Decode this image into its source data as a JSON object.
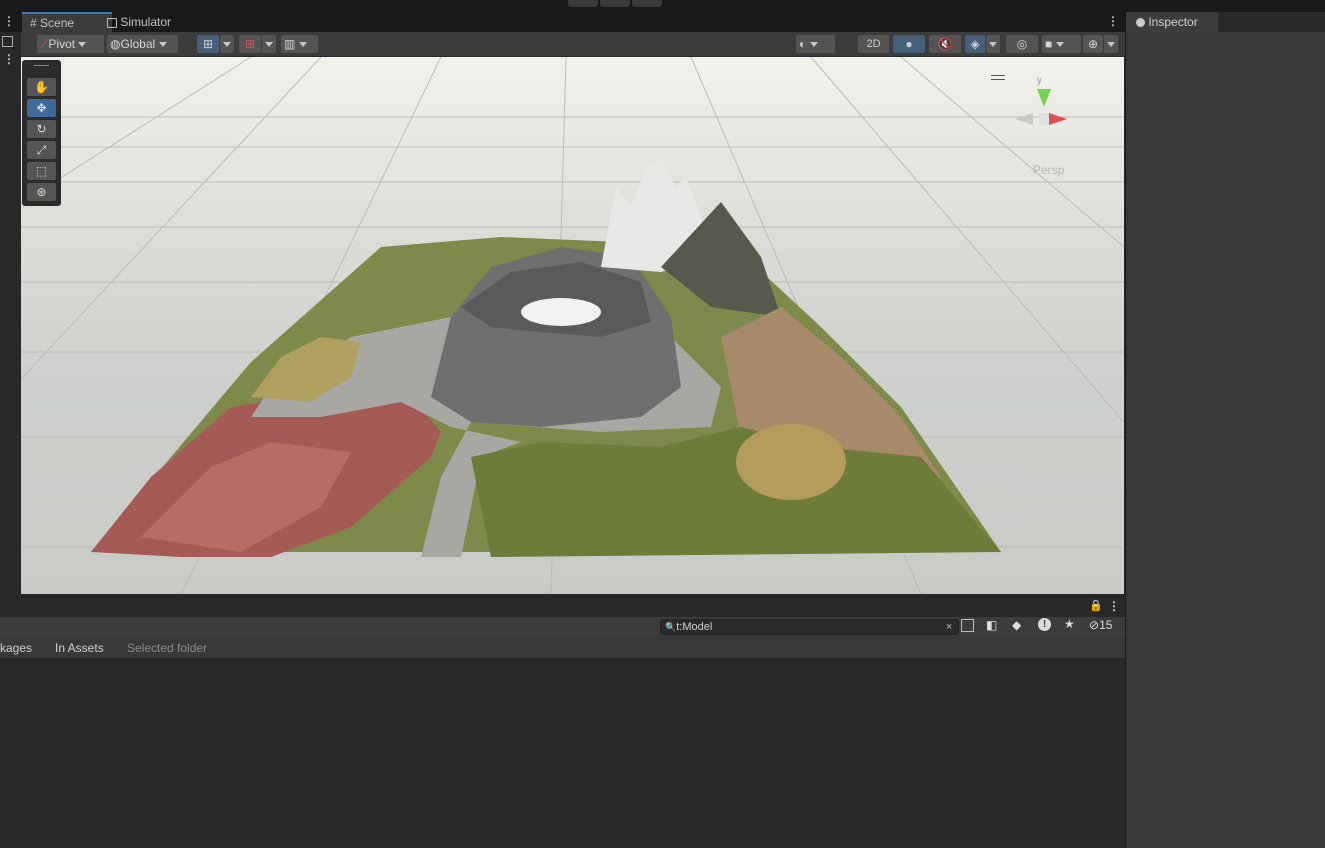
{
  "tabs": {
    "scene": "Scene",
    "simulator": "Simulator",
    "inspector": "Inspector"
  },
  "toolbar": {
    "pivot": "Pivot",
    "global": "Global",
    "mode_2d": "2D"
  },
  "gizmo": {
    "axis_y": "y",
    "view_mode": "Persp"
  },
  "project": {
    "search_value": "t:Model",
    "hidden_count": "15",
    "filters": [
      "kages",
      "In Assets",
      "Selected folder"
    ]
  },
  "icons": {
    "hand": "hand-icon",
    "move": "move-icon",
    "rotate": "rotate-icon",
    "scale": "scale-icon",
    "rect": "rect-transform-icon",
    "transform": "transform-icon"
  },
  "colors": {
    "accent": "#3a79bb",
    "active_button": "#46607c",
    "panel": "#282828"
  }
}
